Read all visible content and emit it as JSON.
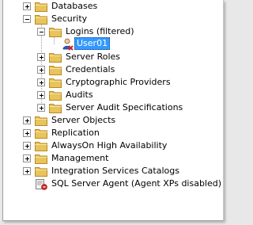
{
  "tree": {
    "databases": "Databases",
    "security": "Security",
    "logins": "Logins (filtered)",
    "user01": "User01",
    "server_roles": "Server Roles",
    "credentials": "Credentials",
    "crypto_providers": "Cryptographic Providers",
    "audits": "Audits",
    "server_audit_specs": "Server Audit Specifications",
    "server_objects": "Server Objects",
    "replication": "Replication",
    "alwayson": "AlwaysOn High Availability",
    "management": "Management",
    "integration_services": "Integration Services Catalogs",
    "sql_agent": "SQL Server Agent (Agent XPs disabled)"
  },
  "colors": {
    "folder": "#e8c45a",
    "folder_dark": "#c89a2c",
    "selection": "#3399ff"
  },
  "icons": {
    "folder": "folder-icon",
    "user": "user-login-icon",
    "agent": "sql-agent-icon"
  }
}
